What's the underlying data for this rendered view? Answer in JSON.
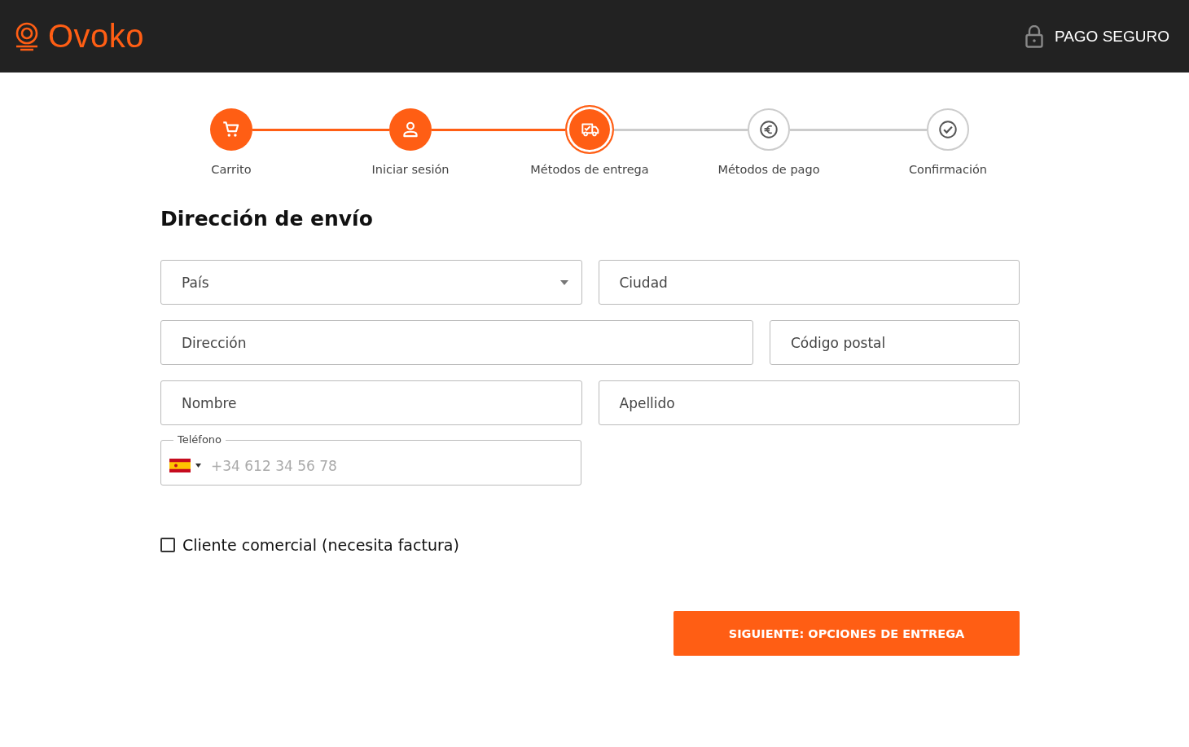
{
  "header": {
    "logo": "Ovoko",
    "secure_label": "PAGO SEGURO"
  },
  "steps": [
    {
      "label": "Carrito",
      "kind": "cart",
      "completed": true,
      "selected": false
    },
    {
      "label": "Iniciar sesión",
      "kind": "user",
      "completed": true,
      "selected": false
    },
    {
      "label": "Métodos de entrega",
      "kind": "truck",
      "completed": true,
      "selected": true
    },
    {
      "label": "Métodos de pago",
      "kind": "euro",
      "completed": false,
      "selected": false
    },
    {
      "label": "Confirmación",
      "kind": "check",
      "completed": false,
      "selected": false
    }
  ],
  "form": {
    "title": "Dirección de envío",
    "rows": [
      [
        {
          "kind": "select",
          "placeholder": "País"
        },
        {
          "kind": "text",
          "placeholder": "Ciudad"
        }
      ],
      [
        {
          "kind": "text",
          "placeholder": "Dirección"
        },
        {
          "kind": "text",
          "placeholder": "Código postal"
        }
      ],
      [
        {
          "kind": "text",
          "placeholder": "Nombre"
        },
        {
          "kind": "text",
          "placeholder": "Apellido"
        }
      ],
      [
        {
          "kind": "phone",
          "label": "Teléfono",
          "placeholder": "+34 612 34 56 78"
        }
      ]
    ],
    "business": {
      "label": "Cliente comercial (necesita factura)",
      "checked": false
    },
    "submit": "SIGUIENTE: OPCIONES DE ENTREGA"
  }
}
